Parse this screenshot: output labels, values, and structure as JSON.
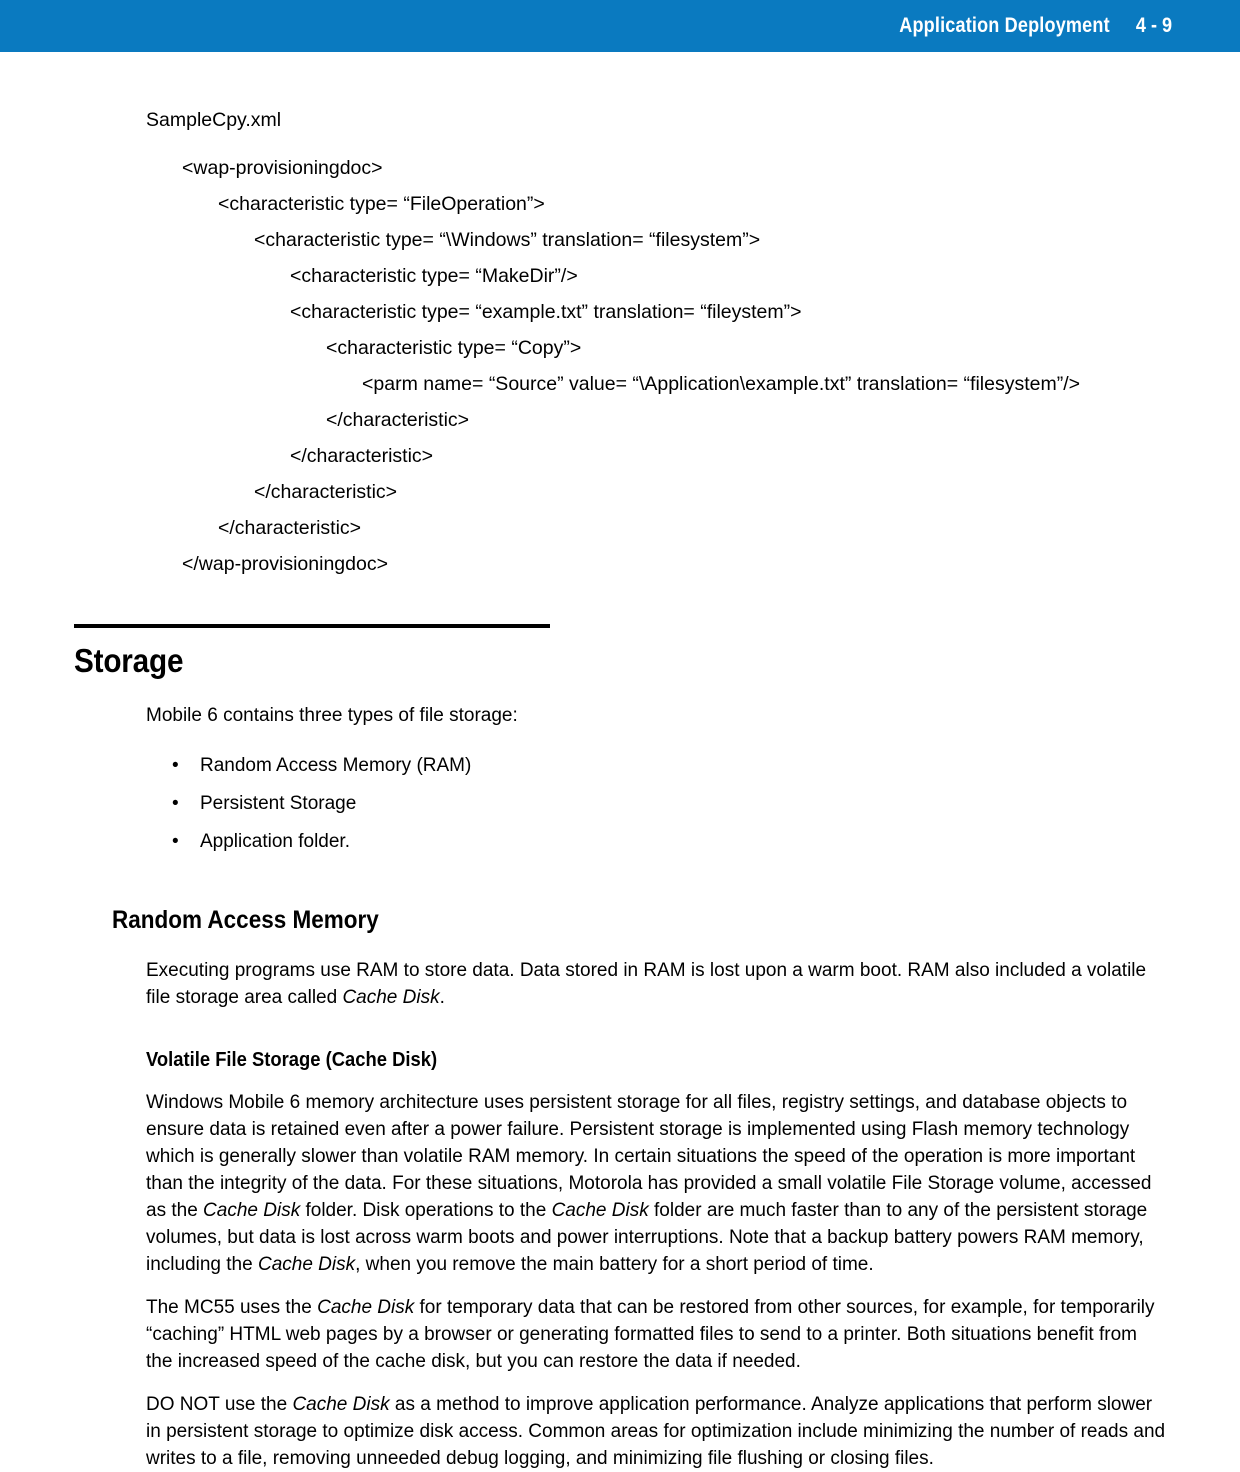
{
  "header": {
    "title": "Application Deployment",
    "page_number": "4 - 9",
    "bar_color": "#0a7ac0",
    "text_color": "#ffffff"
  },
  "code": {
    "label": "SampleCpy.xml",
    "lines": [
      {
        "indent": 1,
        "text": "<wap-provisioningdoc>"
      },
      {
        "indent": 2,
        "text": "<characteristic type= “FileOperation”>"
      },
      {
        "indent": 3,
        "text": "<characteristic type= “\\Windows” translation= “filesystem”>"
      },
      {
        "indent": 4,
        "text": "<characteristic type= “MakeDir”/>"
      },
      {
        "indent": 4,
        "text": "<characteristic type= “example.txt” translation= “fileystem”>"
      },
      {
        "indent": 5,
        "text": "<characteristic type= “Copy”>"
      },
      {
        "indent": 6,
        "text": "<parm name= “Source” value= “\\Application\\example.txt” translation= “filesystem”/>"
      },
      {
        "indent": 5,
        "text": "</characteristic>"
      },
      {
        "indent": 4,
        "text": "</characteristic>"
      },
      {
        "indent": 3,
        "text": "</characteristic>"
      },
      {
        "indent": 2,
        "text": "</characteristic>"
      },
      {
        "indent": 1,
        "text": "</wap-provisioningdoc>"
      }
    ]
  },
  "storage": {
    "heading": "Storage",
    "intro": "Mobile 6 contains three types of file storage:",
    "bullets": [
      "Random Access Memory (RAM)",
      "Persistent Storage",
      "Application folder."
    ]
  },
  "ram": {
    "heading": "Random Access Memory",
    "paragraph_part1": "Executing programs use RAM to store data. Data stored in RAM is lost upon a warm boot. RAM also included a volatile file storage area called ",
    "term": "Cache Disk",
    "paragraph_part2": "."
  },
  "cache_disk": {
    "heading": "Volatile File Storage (Cache Disk)",
    "p1_a": "Windows Mobile 6 memory architecture uses persistent storage for all files, registry settings, and database objects to ensure data is retained even after a power failure. Persistent storage is implemented using Flash memory technology which is generally slower than volatile RAM memory. In certain situations the speed of the operation is more important than the integrity of the data. For these situations, Motorola has provided a small volatile File Storage volume, accessed as the ",
    "p1_term1": "Cache Disk",
    "p1_b": " folder. Disk operations to the ",
    "p1_term2": "Cache Disk",
    "p1_c": " folder are much faster than to any of the persistent storage volumes, but data is lost across warm boots and power interruptions. Note that a backup battery powers RAM memory, including the ",
    "p1_term3": "Cache Disk",
    "p1_d": ", when you remove the main battery for a short period of time.",
    "p2_a": "The MC55 uses the ",
    "p2_term1": "Cache Disk",
    "p2_b": " for temporary data that can be restored from other sources, for example, for temporarily “caching” HTML web pages by a browser or generating formatted files to send to a printer. Both situations benefit from the increased speed of the cache disk, but you can restore the data if needed.",
    "p3_a": "DO NOT use the ",
    "p3_term1": "Cache Disk",
    "p3_b": " as a method to improve application performance. Analyze applications that perform slower in persistent storage to optimize disk access. Common areas for optimization include minimizing the number of reads and writes to a file, removing unneeded debug logging, and minimizing file flushing or closing files."
  }
}
